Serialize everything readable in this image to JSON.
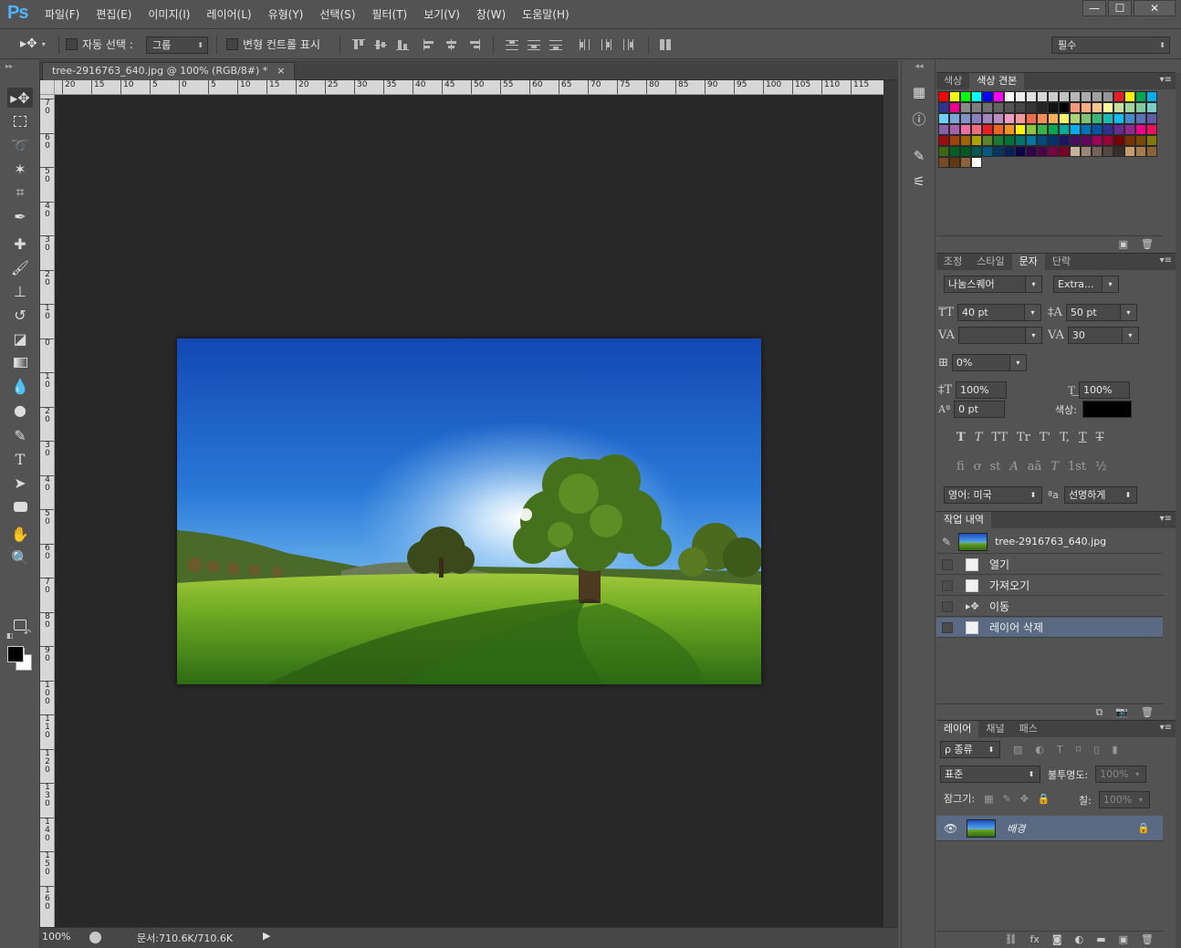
{
  "app": {
    "logo": "Ps",
    "menus": [
      "파일(F)",
      "편집(E)",
      "이미지(I)",
      "레이어(L)",
      "유형(Y)",
      "선택(S)",
      "필터(T)",
      "보기(V)",
      "창(W)",
      "도움말(H)"
    ],
    "window_controls": [
      "—",
      "☐",
      "✕"
    ]
  },
  "options_bar": {
    "auto_select_label": "자동 선택 :",
    "auto_select_target": "그룹",
    "transform_controls_label": "변형 컨트롤 표시",
    "workspace": "필수"
  },
  "document": {
    "tab_title": "tree-2916763_640.jpg @ 100% (RGB/8#) *",
    "tab_close": "×",
    "ruler_h": [
      "20",
      "15",
      "10",
      "5",
      "0",
      "5",
      "10",
      "15",
      "20",
      "25",
      "30",
      "35",
      "40",
      "45",
      "50",
      "55",
      "60",
      "65",
      "70",
      "75",
      "80",
      "85",
      "90",
      "95",
      "100",
      "105",
      "110",
      "115"
    ],
    "ruler_v": [
      "70",
      "60",
      "50",
      "40",
      "30",
      "20",
      "10",
      "0",
      "10",
      "20",
      "30",
      "40",
      "50",
      "60",
      "70",
      "80",
      "90",
      "100",
      "110",
      "120",
      "130",
      "140",
      "150",
      "160"
    ],
    "zoom": "100%",
    "doc_info": "문서:710.6K/710.6K"
  },
  "colors": {
    "accent_blue": "#4fb4ff",
    "selected_row": "#5a6a82",
    "foreground": "#000000",
    "background": "#ffffff",
    "sky_top": "#1346b8",
    "grass": "#5e9a1c"
  },
  "swatches_panel": {
    "tabs": [
      "색상",
      "색상 견본"
    ],
    "active_tab": 1
  },
  "character_panel": {
    "tabs": [
      "조정",
      "스타일",
      "문자",
      "단락"
    ],
    "active_tab": 2,
    "font_family": "나눔스퀘어",
    "font_style": "Extra...",
    "font_size": "40 pt",
    "leading": "50 pt",
    "kerning": "",
    "tracking": "30",
    "tsume": "0%",
    "vertical_scale": "100%",
    "horizontal_scale": "100%",
    "baseline_shift": "0 pt",
    "color_label": "색상:",
    "type_buttons": [
      "T",
      "T",
      "TT",
      "Tr",
      "T'",
      "T,",
      "T",
      "T"
    ],
    "opentype_buttons": [
      "fi",
      "ơ",
      "st",
      "A",
      "aā",
      "T",
      "1st",
      "½"
    ],
    "language": "영어: 미국",
    "aa_label": "ªa",
    "antialias": "선명하게"
  },
  "history_panel": {
    "title": "작업 내역",
    "snapshot": "tree-2916763_640.jpg",
    "items": [
      "열기",
      "가져오기",
      "이동",
      "레이어 삭제"
    ],
    "selected": 3
  },
  "layers_panel": {
    "tabs": [
      "레이어",
      "채널",
      "패스"
    ],
    "active_tab": 0,
    "filter_label": "ρ 종류",
    "blend_mode": "표준",
    "opacity_label": "불투명도:",
    "opacity_value": "100%",
    "lock_label": "잠그기:",
    "fill_label": "칠:",
    "fill_value": "100%",
    "layers": [
      {
        "name": "배경",
        "visible": true,
        "locked": true
      }
    ]
  }
}
